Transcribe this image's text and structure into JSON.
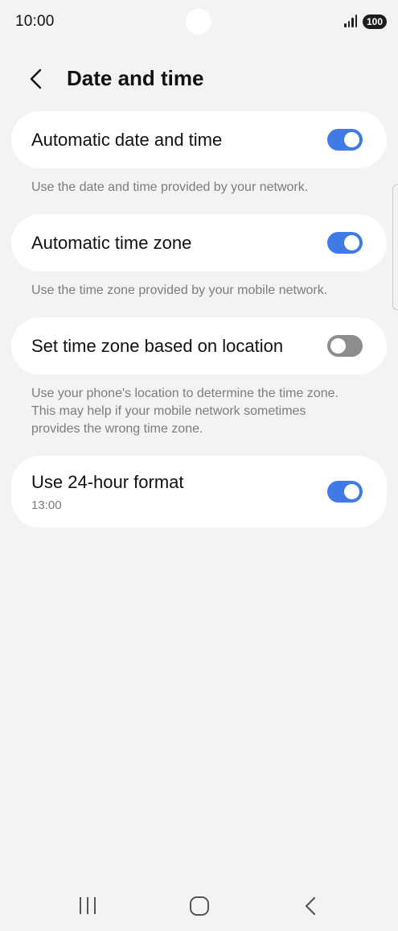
{
  "status_bar": {
    "time": "10:00",
    "battery": "100",
    "icons": [
      "signal-icon",
      "battery-icon"
    ]
  },
  "header": {
    "title": "Date and time",
    "back_icon": "chevron-left-icon"
  },
  "settings": [
    {
      "label": "Automatic date and time",
      "enabled": true,
      "description": "Use the date and time provided by your network."
    },
    {
      "label": "Automatic time zone",
      "enabled": true,
      "description": "Use the time zone provided by your mobile network."
    },
    {
      "label": "Set time zone based on location",
      "enabled": false,
      "description": "Use your phone's location to determine the time zone. This may help if your mobile network sometimes provides the wrong time zone."
    },
    {
      "label": "Use 24-hour format",
      "sublabel": "13:00",
      "enabled": true
    }
  ],
  "nav_bar": {
    "icons": [
      "recents-icon",
      "home-icon",
      "back-icon"
    ]
  },
  "colors": {
    "background": "#f3f3f5",
    "card": "#ffffff",
    "toggle_on": "#3f7ae6",
    "toggle_off": "#8d8d8f",
    "description_text": "#7c7c7e"
  }
}
